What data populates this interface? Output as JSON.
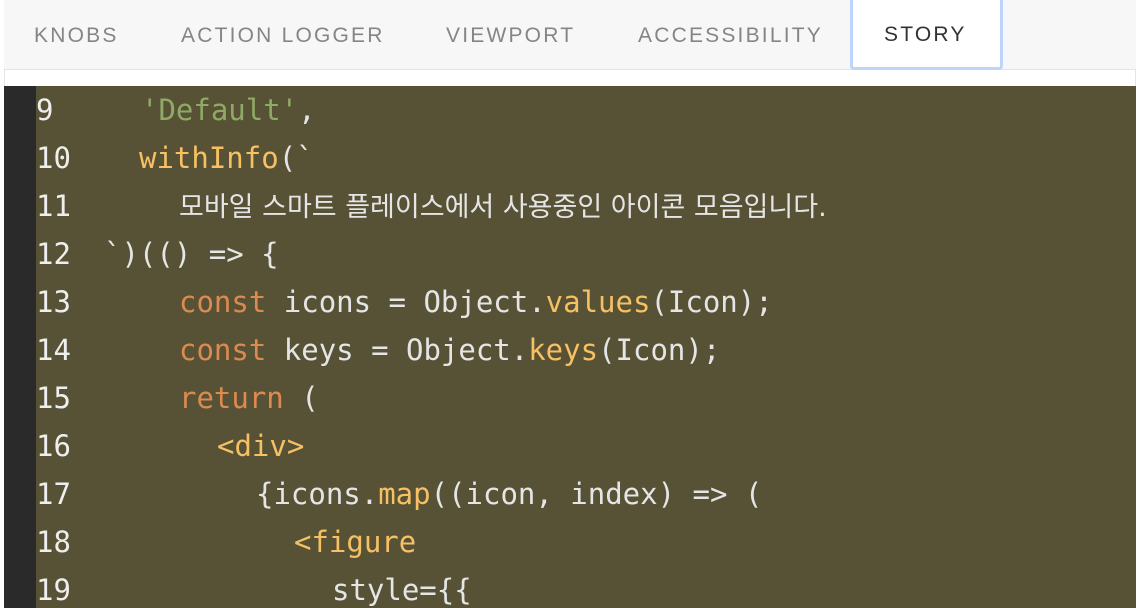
{
  "tabs": [
    {
      "label": "KNOBS",
      "active": false
    },
    {
      "label": "ACTION LOGGER",
      "active": false
    },
    {
      "label": "VIEWPORT",
      "active": false
    },
    {
      "label": "ACCESSIBILITY",
      "active": false
    },
    {
      "label": "STORY",
      "active": true
    }
  ],
  "code": {
    "lines": [
      {
        "number": "9",
        "tokens": [
          {
            "text": "'Default'",
            "type": "str"
          },
          {
            "text": ",",
            "type": "txt"
          }
        ]
      },
      {
        "number": "10",
        "tokens": [
          {
            "text": "withInfo",
            "type": "fn"
          },
          {
            "text": "(`",
            "type": "txt"
          }
        ]
      },
      {
        "number": "11",
        "tokens": [
          {
            "text": "모바일 스마트 플레이스에서 사용중인 아이콘 모음입니다.",
            "type": "kr"
          }
        ]
      },
      {
        "number": "12",
        "tokens": [
          {
            "text": "`)(() => {",
            "type": "txt"
          }
        ]
      },
      {
        "number": "13",
        "tokens": [
          {
            "text": "const",
            "type": "kw"
          },
          {
            "text": " icons = Object.",
            "type": "txt"
          },
          {
            "text": "values",
            "type": "fn"
          },
          {
            "text": "(Icon);",
            "type": "txt"
          }
        ]
      },
      {
        "number": "14",
        "tokens": [
          {
            "text": "const",
            "type": "kw"
          },
          {
            "text": " keys = Object.",
            "type": "txt"
          },
          {
            "text": "keys",
            "type": "fn"
          },
          {
            "text": "(Icon);",
            "type": "txt"
          }
        ]
      },
      {
        "number": "15",
        "tokens": [
          {
            "text": "return",
            "type": "kw"
          },
          {
            "text": " (",
            "type": "txt"
          }
        ]
      },
      {
        "number": "16",
        "tokens": [
          {
            "text": "<div>",
            "type": "tag"
          }
        ]
      },
      {
        "number": "17",
        "tokens": [
          {
            "text": "{icons.",
            "type": "txt"
          },
          {
            "text": "map",
            "type": "fn"
          },
          {
            "text": "((icon, index) => (",
            "type": "txt"
          }
        ]
      },
      {
        "number": "18",
        "tokens": [
          {
            "text": "<figure",
            "type": "tag"
          }
        ]
      },
      {
        "number": "19",
        "tokens": [
          {
            "text": "style={{",
            "type": "txt"
          }
        ]
      }
    ]
  }
}
